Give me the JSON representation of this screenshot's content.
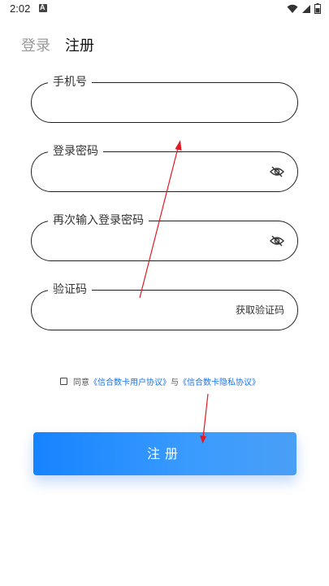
{
  "status_bar": {
    "time": "2:02"
  },
  "tabs": [
    {
      "label": "登录",
      "active": false
    },
    {
      "label": "注册",
      "active": true
    }
  ],
  "fields": {
    "phone": {
      "label": "手机号",
      "value": ""
    },
    "password": {
      "label": "登录密码",
      "value": ""
    },
    "confirm_password": {
      "label": "再次输入登录密码",
      "value": ""
    },
    "code": {
      "label": "验证码",
      "value": "",
      "action_label": "获取验证码"
    }
  },
  "agreement": {
    "prefix": "同意",
    "user_agreement": "《信合数卡用户协议》",
    "connector": "与",
    "privacy_agreement": "《信合数卡隐私协议》",
    "checked": false
  },
  "submit": {
    "label": "注册"
  },
  "colors": {
    "accent": "#1683ff",
    "link": "#1a73e8",
    "annotation": "#e01b24"
  },
  "icons": [
    "wifi-icon",
    "signal-icon",
    "battery-icon",
    "eye-off-icon"
  ]
}
